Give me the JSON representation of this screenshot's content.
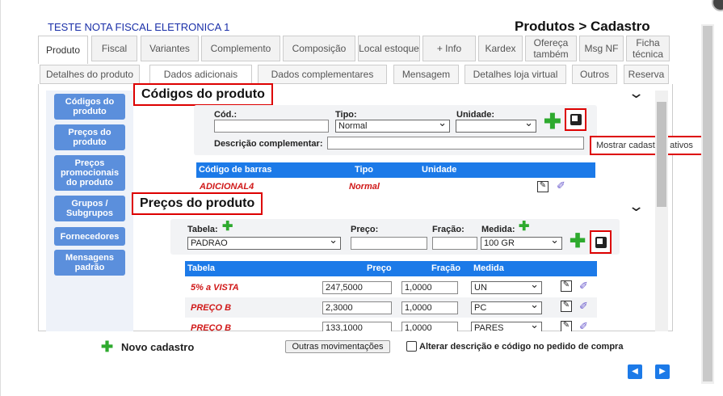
{
  "app_title": "TESTE NOTA FISCAL ELETRONICA 1",
  "page_title": "Produtos > Cadastro",
  "tabs": [
    {
      "label": "Produto"
    },
    {
      "label": "Fiscal"
    },
    {
      "label": "Variantes"
    },
    {
      "label": "Complemento"
    },
    {
      "label": "Composição"
    },
    {
      "label": "Local estoque"
    },
    {
      "label": "+ Info"
    },
    {
      "label": "Kardex"
    },
    {
      "label": "Ofereça também"
    },
    {
      "label": "Msg NF"
    },
    {
      "label": "Ficha técnica"
    }
  ],
  "subtabs": [
    {
      "label": "Detalhes do produto"
    },
    {
      "label": "Dados adicionais"
    },
    {
      "label": "Dados complementares"
    },
    {
      "label": "Mensagem"
    },
    {
      "label": "Detalhes loja virtual"
    },
    {
      "label": "Outros"
    },
    {
      "label": "Reserva"
    }
  ],
  "sidebar": [
    {
      "label": "Códigos do produto"
    },
    {
      "label": "Preços do produto"
    },
    {
      "label": "Preços promocionais do produto"
    },
    {
      "label": "Grupos / Subgrupos"
    },
    {
      "label": "Fornecedores"
    },
    {
      "label": "Mensagens padrão"
    }
  ],
  "codigos": {
    "title": "Códigos do produto",
    "cod_label": "Cód.:",
    "cod_value": "",
    "tipo_label": "Tipo:",
    "tipo_value": "Normal",
    "unidade_label": "Unidade:",
    "unidade_value": "",
    "desc_label": "Descrição complementar:",
    "desc_value": "",
    "tooltip": "Mostrar cadastros ativos",
    "table": {
      "headers": [
        "Código de barras",
        "Tipo",
        "Unidade"
      ],
      "rows": [
        {
          "codigo": "ADICIONAL4",
          "tipo": "Normal",
          "unidade": ""
        }
      ]
    }
  },
  "precos": {
    "title": "Preços do produto",
    "tabela_label": "Tabela:",
    "tabela_value": "PADRAO",
    "preco_label": "Preço:",
    "preco_value": "",
    "fracao_label": "Fração:",
    "fracao_value": "",
    "medida_label": "Medida:",
    "medida_value": "100 GR",
    "table": {
      "headers": [
        "Tabela",
        "Preço",
        "Fração",
        "Medida"
      ],
      "rows": [
        {
          "tabela": "5% a VISTA",
          "preco": "247,5000",
          "fracao": "1,0000",
          "medida": "UN"
        },
        {
          "tabela": "PREÇO B",
          "preco": "2,3000",
          "fracao": "1,0000",
          "medida": "PC"
        },
        {
          "tabela": "PREÇO B",
          "preco": "133,1000",
          "fracao": "1,0000",
          "medida": "PARES"
        }
      ]
    }
  },
  "footer": {
    "novo": "Novo cadastro",
    "outras": "Outras movimentações",
    "alterar": "Alterar descrição e código no pedido de compra"
  },
  "colors": {
    "accent": "#1c7ae8",
    "nav": "#5b8fdc",
    "highlight": "#dd0000",
    "plus": "#2eaa2e"
  }
}
